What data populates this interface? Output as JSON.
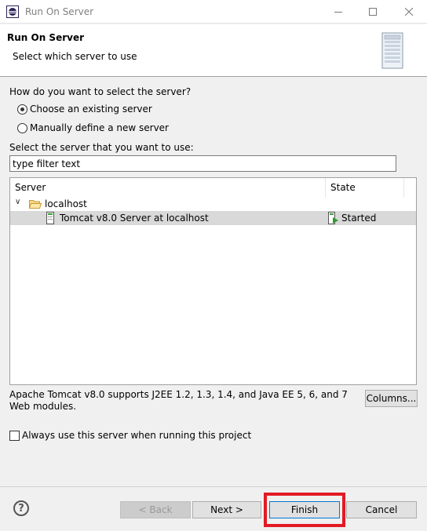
{
  "window": {
    "title": "Run On Server",
    "controls": [
      "minimize",
      "maximize",
      "close"
    ]
  },
  "header": {
    "title": "Run On Server",
    "subtitle": "Select which server to use",
    "icon": "server-tower-icon"
  },
  "selection": {
    "question": "How do you want to select the server?",
    "options": [
      {
        "label": "Choose an existing server",
        "selected": true
      },
      {
        "label": "Manually define a new server",
        "selected": false
      }
    ]
  },
  "filter": {
    "label": "Select the server that you want to use:",
    "value": "type filter text"
  },
  "table": {
    "columns": [
      "Server",
      "State"
    ],
    "group": {
      "label": "localhost",
      "expanded": true,
      "icon": "folder-open-icon"
    },
    "rows": [
      {
        "server": "Tomcat v8.0 Server at localhost",
        "state": "Started",
        "selected": true
      }
    ]
  },
  "description": "Apache Tomcat v8.0 supports J2EE 1.2, 1.3, 1.4, and Java EE 5, 6, and 7 Web modules.",
  "columns_button": "Columns...",
  "always_use": {
    "label": "Always use this server when running this project",
    "checked": false
  },
  "footer": {
    "help": "?",
    "back": "< Back",
    "next": "Next >",
    "finish": "Finish",
    "cancel": "Cancel",
    "highlight_color": "#e21a24"
  }
}
